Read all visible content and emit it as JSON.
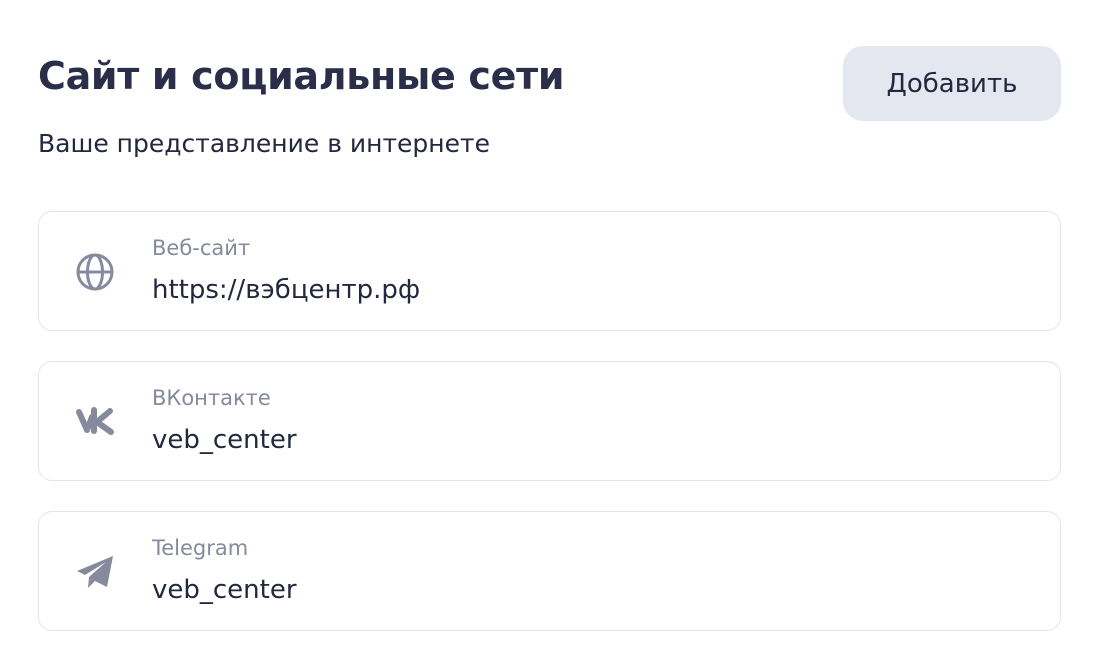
{
  "header": {
    "title": "Сайт и социальные сети",
    "subtitle": "Ваше представление в интернете",
    "add_label": "Добавить"
  },
  "links": [
    {
      "label": "Веб-сайт",
      "value": "https://вэбцентр.рф",
      "icon": "globe-icon"
    },
    {
      "label": "ВКонтакте",
      "value": "veb_center",
      "icon": "vk-icon"
    },
    {
      "label": "Telegram",
      "value": "veb_center",
      "icon": "telegram-icon"
    }
  ],
  "colors": {
    "icon": "#858a9d",
    "button_bg": "#e4e7ef",
    "text": "#23283e",
    "label": "#858a9d",
    "border": "#e3e5ea"
  }
}
